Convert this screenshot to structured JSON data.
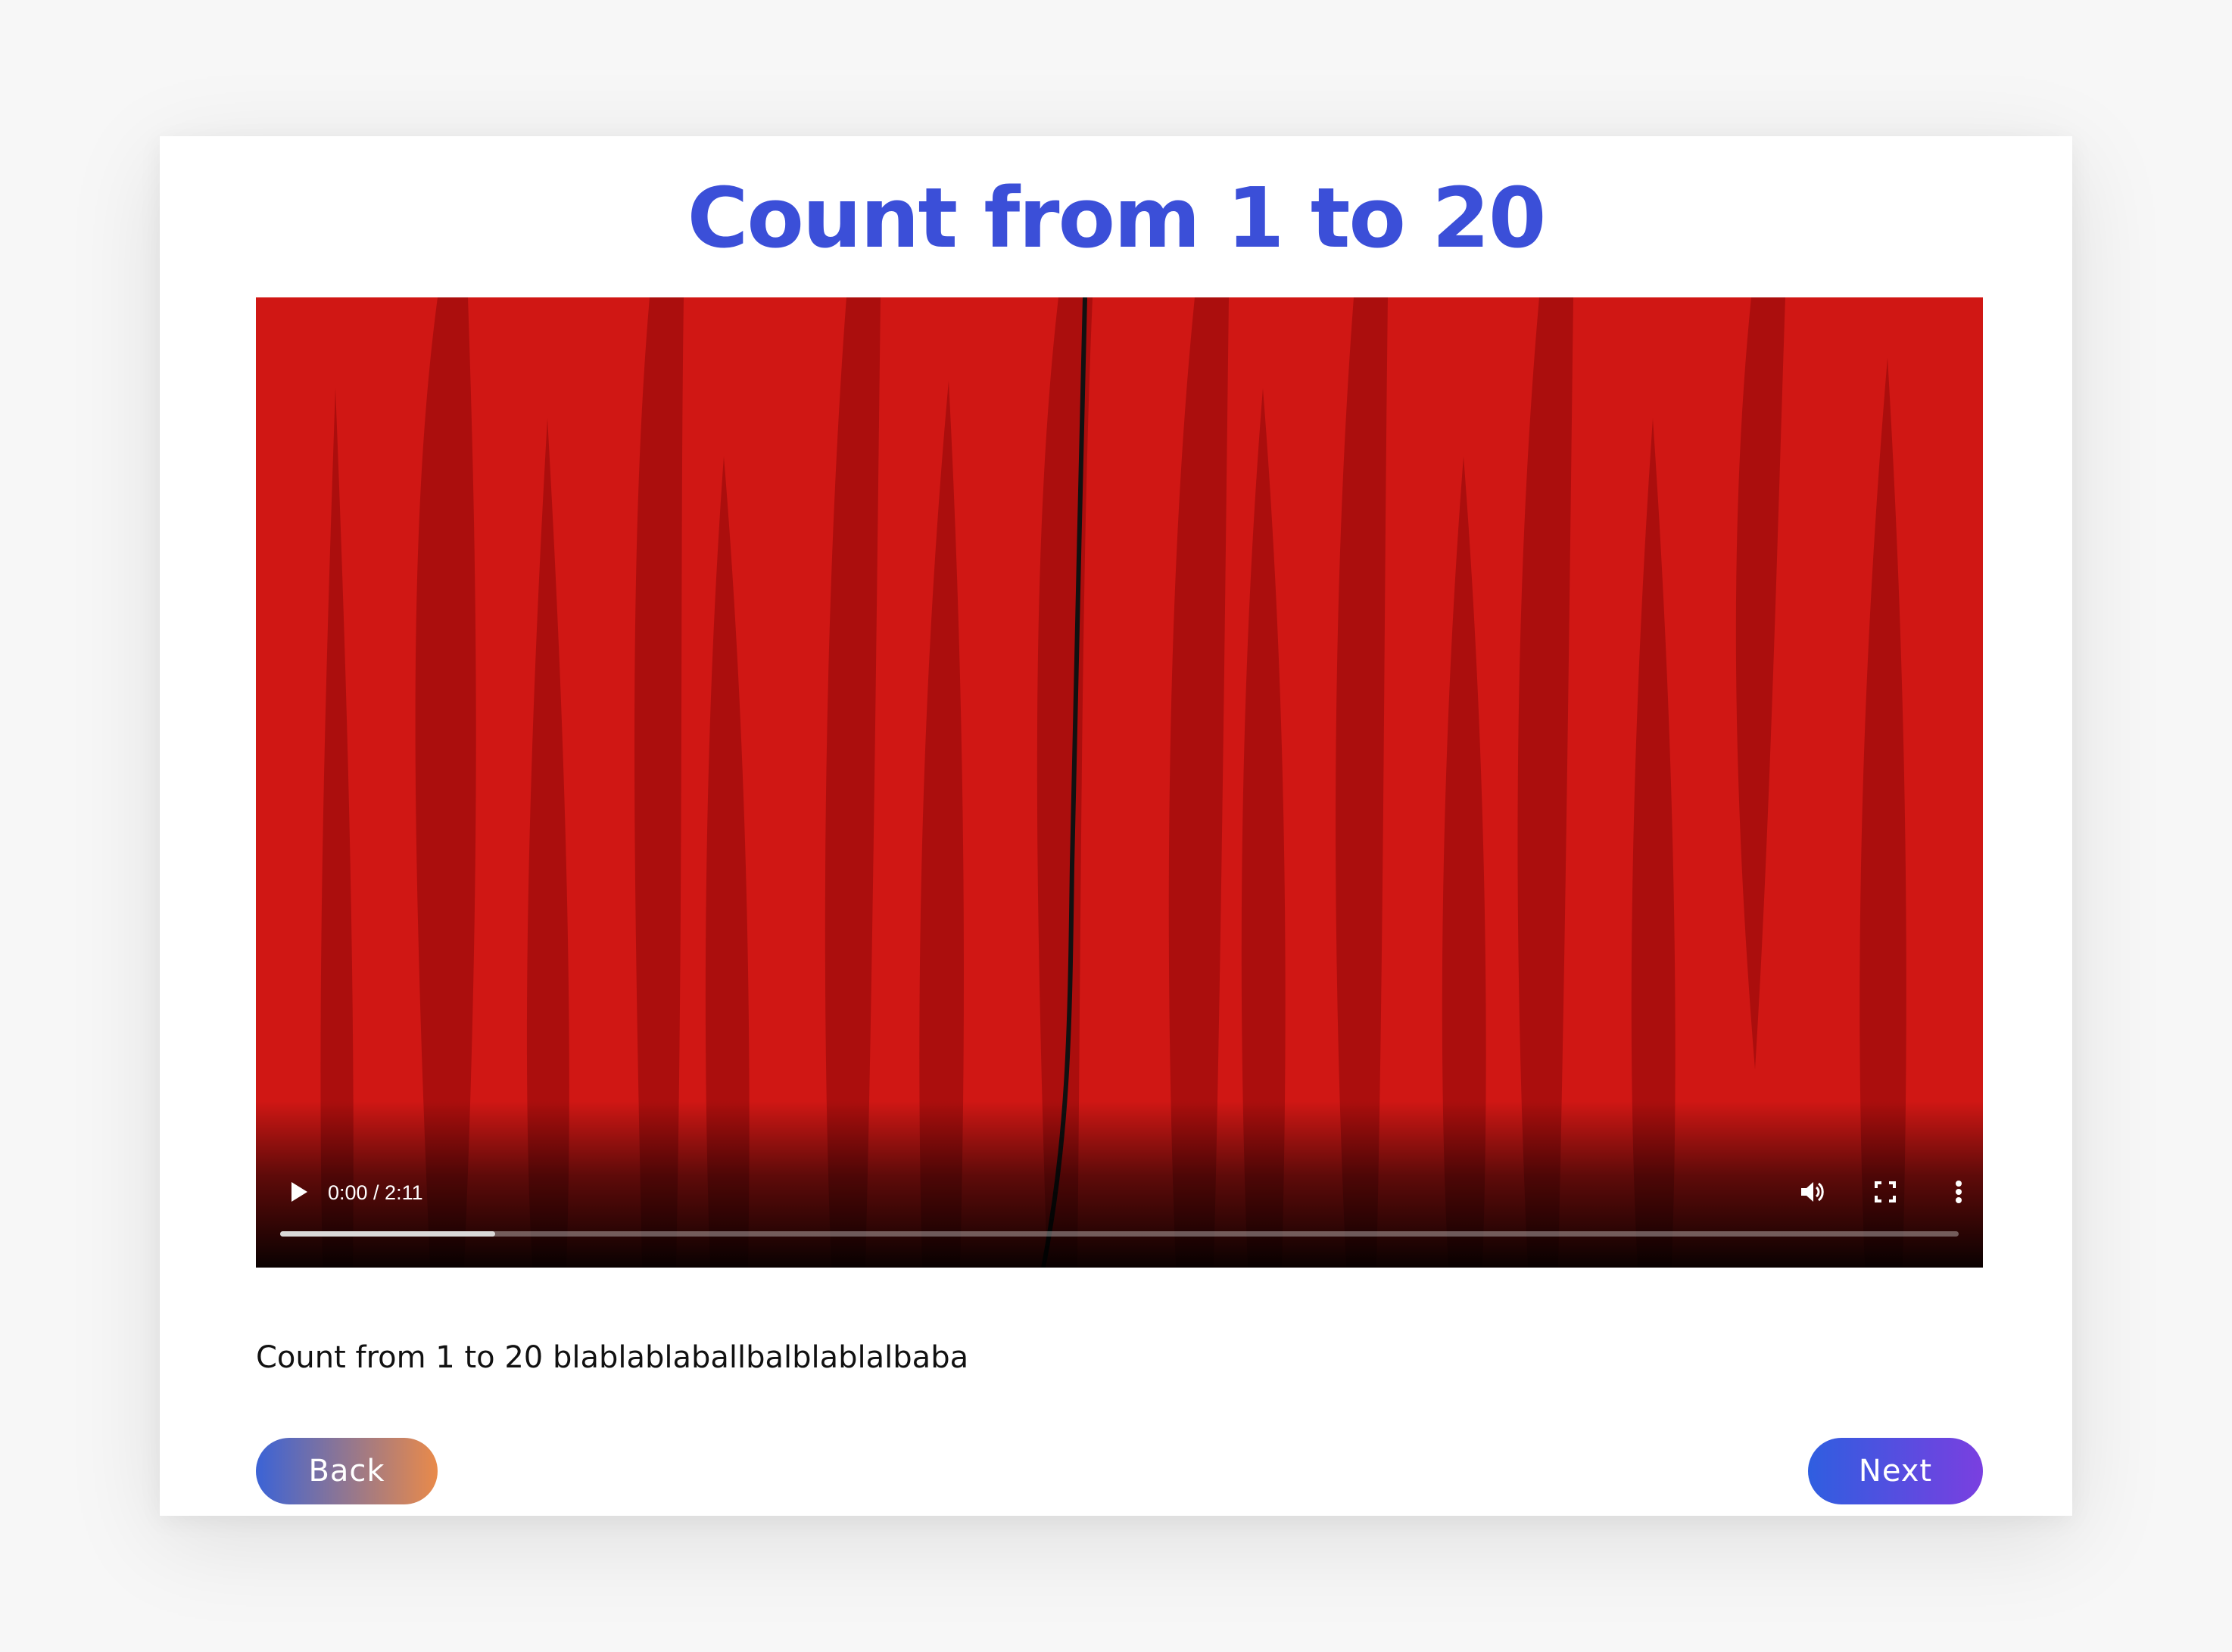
{
  "page": {
    "title": "Count from 1 to 20",
    "description": "Count from 1 to 20 blablablaballbalblablalbaba"
  },
  "video": {
    "time_display": "0:00 / 2:11",
    "current_time": "0:00",
    "duration": "2:11",
    "buffered_fraction": 0.128,
    "played_fraction": 0.0,
    "controls": {
      "play_icon": "play-icon",
      "volume_icon": "volume-icon",
      "fullscreen_icon": "fullscreen-icon",
      "menu_icon": "more-vert-icon"
    },
    "poster_colors": {
      "base": "#d01714",
      "fold": "#a50d0c",
      "seam": "#111111"
    }
  },
  "navigation": {
    "back_label": "Back",
    "next_label": "Next"
  },
  "colors": {
    "title": "#3b4fd8",
    "back_gradient": [
      "#3b63d6",
      "#e98a4a"
    ],
    "next_gradient": [
      "#2f5ee0",
      "#7a3fe0"
    ]
  }
}
